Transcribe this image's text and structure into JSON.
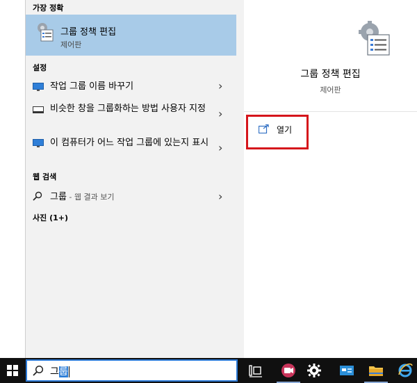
{
  "sections": {
    "best_match": "가장 정확",
    "settings": "설정",
    "web_search": "웹 검색",
    "photos": "사진 (1+)"
  },
  "best_match_item": {
    "title": "그룹 정책 편집",
    "subtitle": "제어판"
  },
  "settings_items": [
    {
      "label": "작업 그룹 이름 바꾸기",
      "icon": "monitor-icon"
    },
    {
      "label": "비슷한 창을 그룹화하는 방법 사용자 지정",
      "icon": "taskbar-icon"
    },
    {
      "label": "이 컴퓨터가 어느 작업 그룹에 있는지 표시",
      "icon": "monitor-icon"
    }
  ],
  "web_item": {
    "label": "그룹",
    "suffix": " - 웹 결과 보기"
  },
  "preview": {
    "title": "그룹 정책 편집",
    "subtitle": "제어판",
    "open_label": "열기"
  },
  "search": {
    "prefix": "그",
    "selected": "룹"
  },
  "colors": {
    "selection": "#a8cbe8",
    "highlight_box": "#d5151b",
    "taskbar": "#101010",
    "search_border": "#2b79d6"
  }
}
